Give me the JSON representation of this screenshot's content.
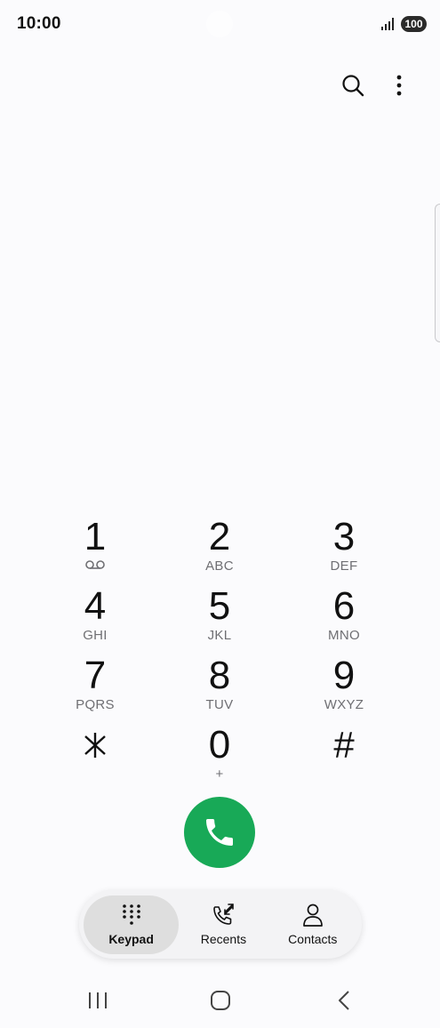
{
  "status": {
    "time": "10:00",
    "battery": "100",
    "signal_icon": "signal-bars-icon"
  },
  "toolbar": {
    "search_icon": "search-icon",
    "more_icon": "more-vertical-icon"
  },
  "keypad": {
    "keys": [
      {
        "digit": "1",
        "letters": "",
        "sub_icon": "voicemail-icon"
      },
      {
        "digit": "2",
        "letters": "ABC"
      },
      {
        "digit": "3",
        "letters": "DEF"
      },
      {
        "digit": "4",
        "letters": "GHI"
      },
      {
        "digit": "5",
        "letters": "JKL"
      },
      {
        "digit": "6",
        "letters": "MNO"
      },
      {
        "digit": "7",
        "letters": "PQRS"
      },
      {
        "digit": "8",
        "letters": "TUV"
      },
      {
        "digit": "9",
        "letters": "WXYZ"
      },
      {
        "digit": "*",
        "letters": ""
      },
      {
        "digit": "0",
        "letters": "+"
      },
      {
        "digit": "#",
        "letters": ""
      }
    ]
  },
  "call": {
    "icon": "phone-icon",
    "color": "#18a957"
  },
  "nav": {
    "items": [
      {
        "label": "Keypad",
        "icon": "dialpad-icon",
        "active": true
      },
      {
        "label": "Recents",
        "icon": "recent-calls-icon",
        "active": false
      },
      {
        "label": "Contacts",
        "icon": "person-icon",
        "active": false
      }
    ]
  },
  "system_nav": {
    "recents_icon": "recent-apps-icon",
    "home_icon": "home-icon",
    "back_icon": "back-icon"
  }
}
